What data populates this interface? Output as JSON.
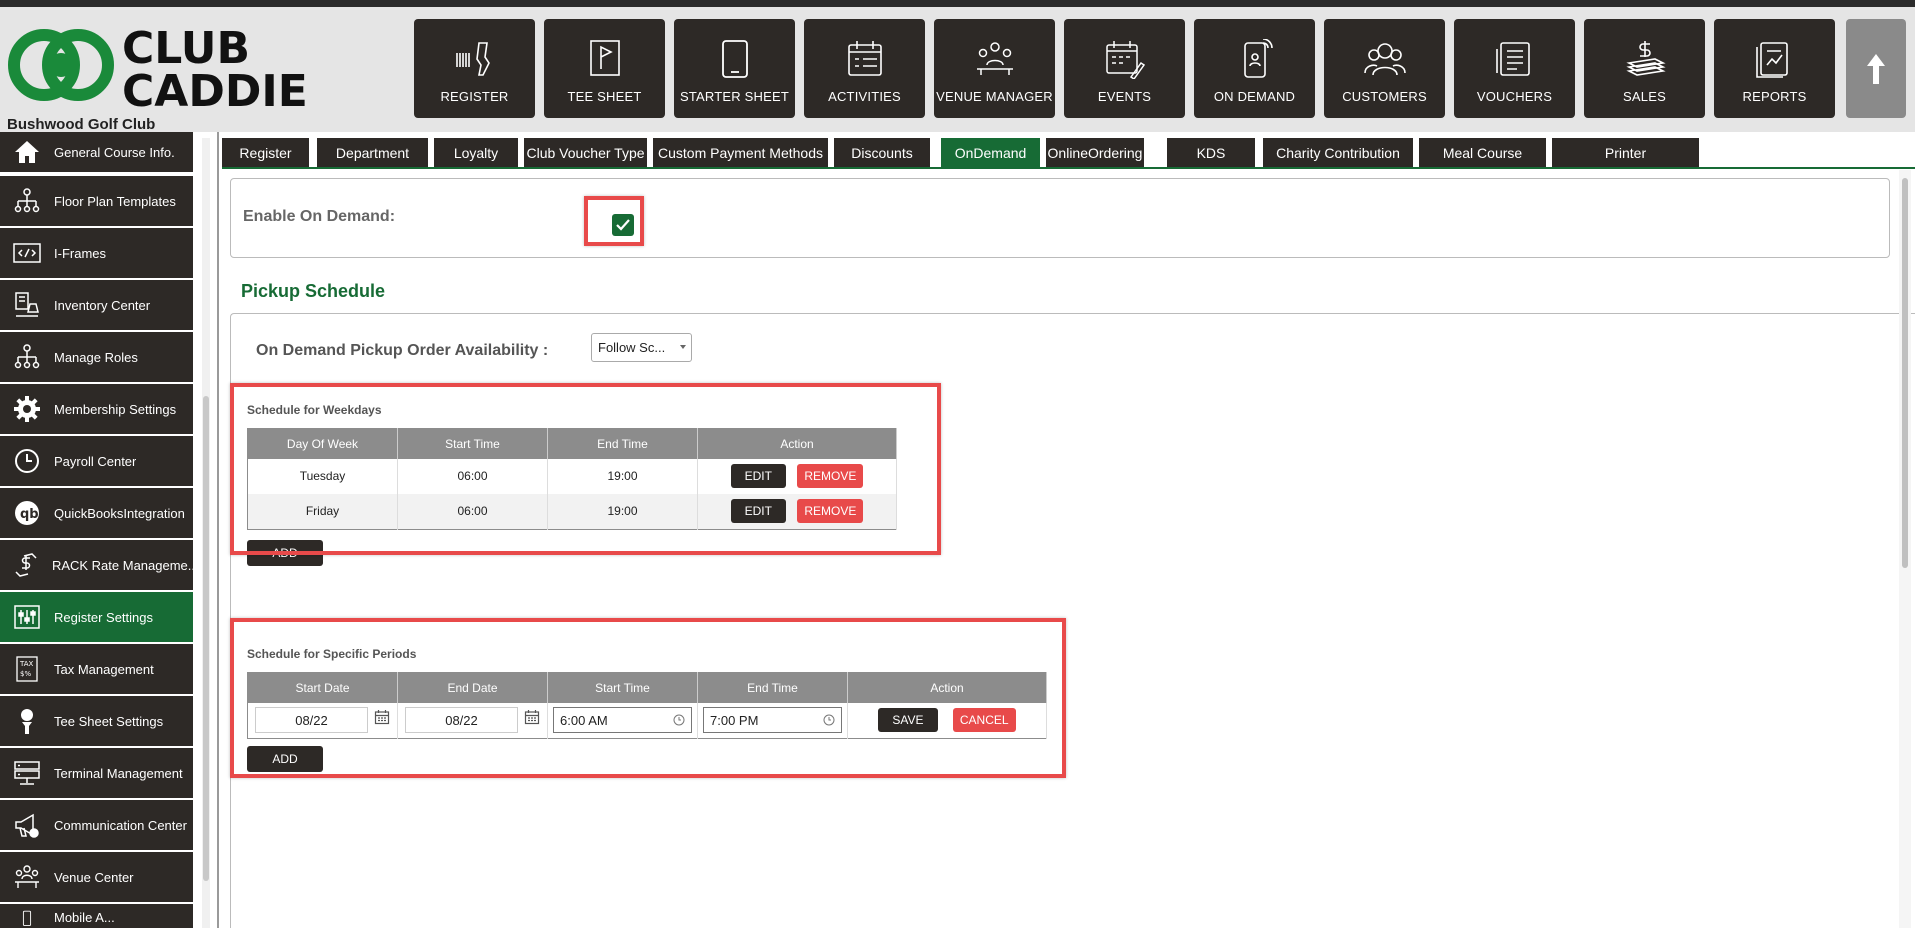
{
  "header": {
    "logo_line1": "CLUB",
    "logo_line2": "CADDIE",
    "club_name": "Bushwood Golf Club",
    "nav": [
      {
        "label": "REGISTER",
        "icon": "barcode-scanner-icon"
      },
      {
        "label": "TEE SHEET",
        "icon": "flag-icon"
      },
      {
        "label": "STARTER SHEET",
        "icon": "tablet-icon"
      },
      {
        "label": "ACTIVITIES",
        "icon": "calendar-list-icon"
      },
      {
        "label": "VENUE MANAGER",
        "icon": "meeting-icon"
      },
      {
        "label": "EVENTS",
        "icon": "calendar-edit-icon"
      },
      {
        "label": "ON DEMAND",
        "icon": "mobile-order-icon"
      },
      {
        "label": "CUSTOMERS",
        "icon": "people-icon"
      },
      {
        "label": "VOUCHERS",
        "icon": "voucher-icon"
      },
      {
        "label": "SALES",
        "icon": "money-icon"
      },
      {
        "label": "REPORTS",
        "icon": "report-icon"
      }
    ]
  },
  "sidebar": {
    "items": [
      {
        "label": "General Course Info.",
        "icon": "home-icon"
      },
      {
        "label": "Floor Plan Templates",
        "icon": "hierarchy-icon"
      },
      {
        "label": "I-Frames",
        "icon": "code-icon"
      },
      {
        "label": "Inventory Center",
        "icon": "inventory-icon"
      },
      {
        "label": "Manage Roles",
        "icon": "roles-icon"
      },
      {
        "label": "Membership Settings",
        "icon": "gear-icon"
      },
      {
        "label": "Payroll Center",
        "icon": "clock-icon"
      },
      {
        "label": "QuickBooksIntegration",
        "icon": "quickbooks-icon"
      },
      {
        "label": "RACK Rate Manageme...",
        "icon": "rate-icon"
      },
      {
        "label": "Register Settings",
        "icon": "sliders-icon",
        "active": true
      },
      {
        "label": "Tax Management",
        "icon": "tax-icon"
      },
      {
        "label": "Tee Sheet Settings",
        "icon": "golf-tee-icon"
      },
      {
        "label": "Terminal Management",
        "icon": "terminal-icon"
      },
      {
        "label": "Communication Center",
        "icon": "megaphone-icon"
      },
      {
        "label": "Venue Center",
        "icon": "venue-icon"
      },
      {
        "label": "Mobile A...",
        "icon": "mobile-icon"
      }
    ]
  },
  "tabs": [
    {
      "label": "Register"
    },
    {
      "label": "Department"
    },
    {
      "label": "Loyalty"
    },
    {
      "label": "Club Voucher Type"
    },
    {
      "label": "Custom Payment Methods"
    },
    {
      "label": "Discounts"
    },
    {
      "label": "OnDemand",
      "active": true
    },
    {
      "label": "OnlineOrdering"
    },
    {
      "label": "KDS"
    },
    {
      "label": "Charity Contribution"
    },
    {
      "label": "Meal Course"
    },
    {
      "label": "Printer"
    }
  ],
  "on_demand": {
    "enable_label": "Enable On Demand:",
    "enabled": true,
    "pickup_title": "Pickup Schedule",
    "availability_label": "On Demand Pickup Order Availability :",
    "availability_value": "Follow Sc...",
    "weekdays": {
      "title": "Schedule for Weekdays",
      "columns": [
        "Day Of Week",
        "Start Time",
        "End Time",
        "Action"
      ],
      "rows": [
        {
          "day": "Tuesday",
          "start": "06:00",
          "end": "19:00"
        },
        {
          "day": "Friday",
          "start": "06:00",
          "end": "19:00"
        }
      ],
      "edit_label": "EDIT",
      "remove_label": "REMOVE",
      "add_label": "ADD"
    },
    "periods": {
      "title": "Schedule for Specific Periods",
      "columns": [
        "Start Date",
        "End Date",
        "Start Time",
        "End Time",
        "Action"
      ],
      "row": {
        "start_date": "08/22",
        "end_date": "08/22",
        "start_time": "6:00 AM",
        "end_time": "7:00 PM"
      },
      "save_label": "SAVE",
      "cancel_label": "CANCEL",
      "add_label": "ADD"
    }
  },
  "colors": {
    "brand_green": "#176b35",
    "dark": "#2d2926",
    "highlight_red": "#e84a4a"
  }
}
